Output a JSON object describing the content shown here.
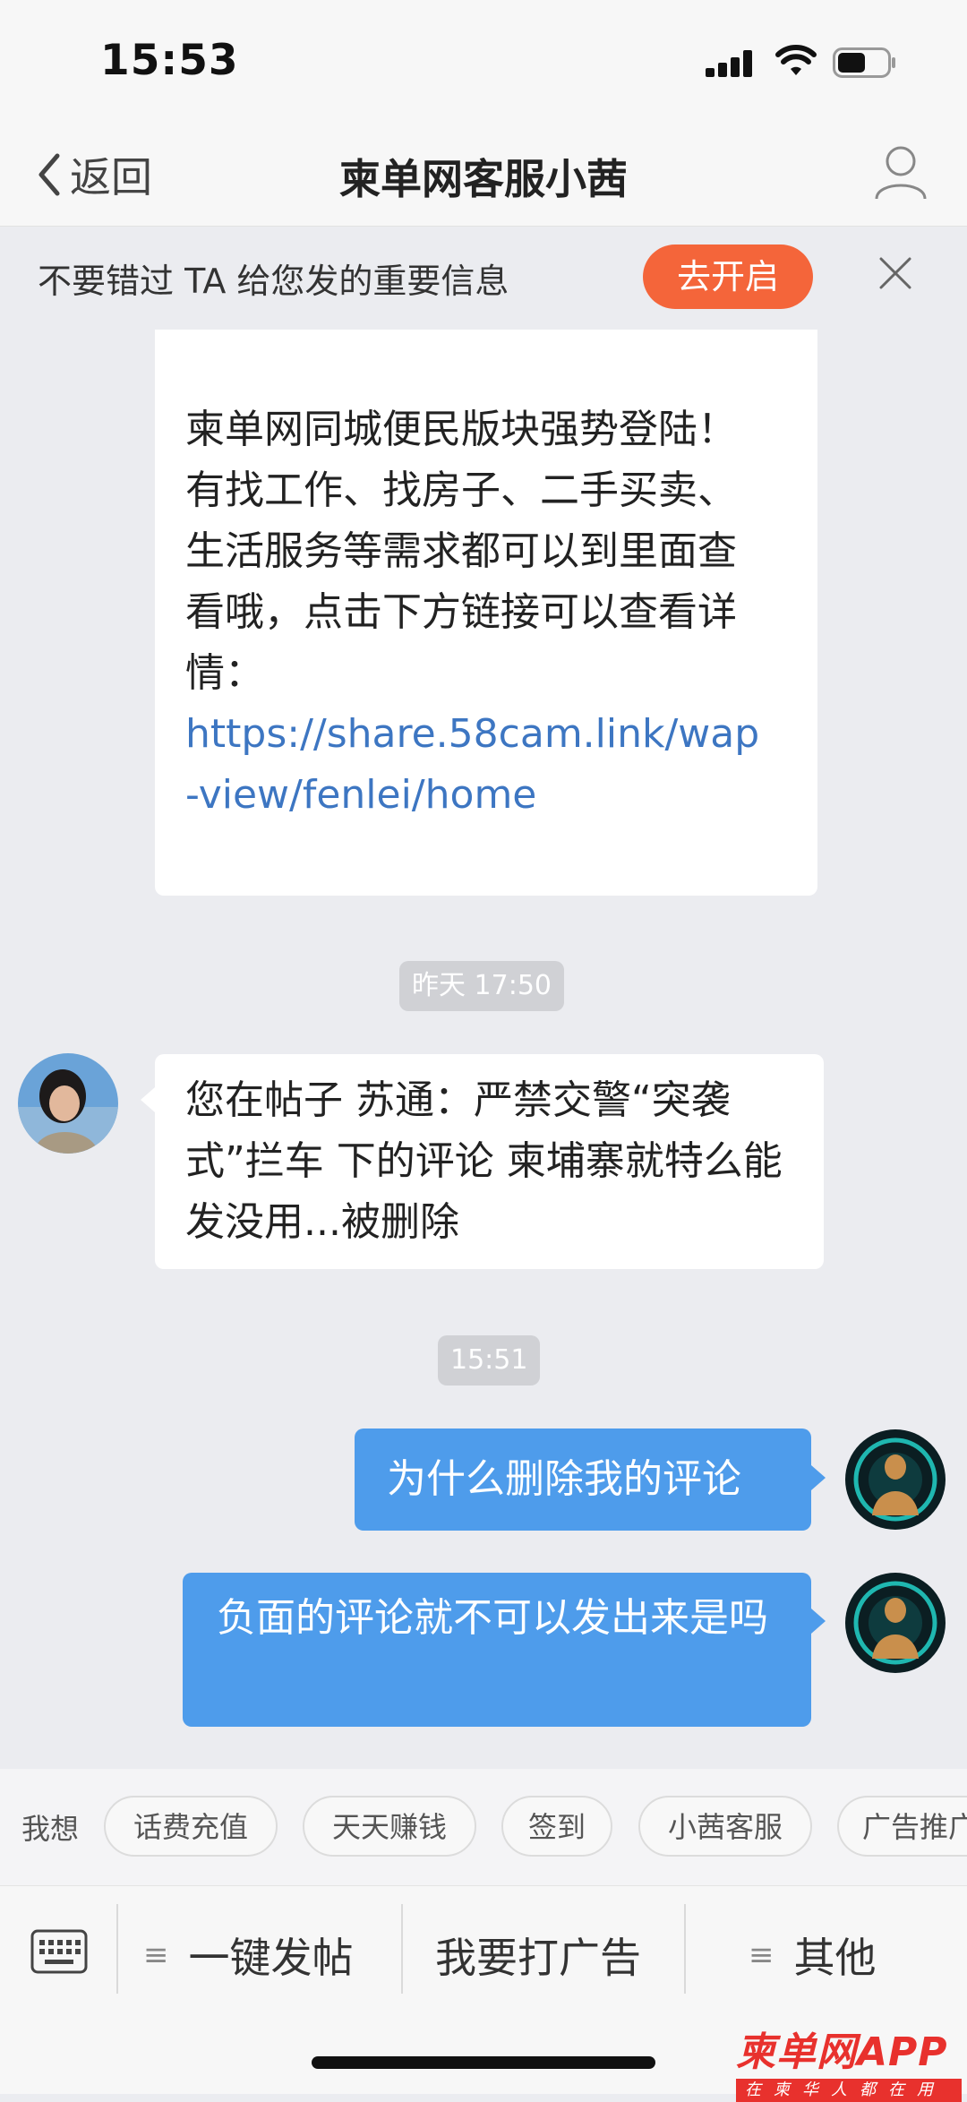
{
  "status_bar": {
    "time": "15:53"
  },
  "nav": {
    "back_label": "返回",
    "title": "柬单网客服小茜"
  },
  "banner": {
    "text": "不要错过 TA 给您发的重要信息",
    "button": "去开启"
  },
  "messages": {
    "m1_text": "柬单网同城便民版块强势登陆！有找工作、找房子、二手买卖、生活服务等需求都可以到里面查看哦，点击下方链接可以查看详情：",
    "m1_link": "https://share.58cam.link/wap-view/fenlei/home",
    "ts1": "昨天 17:50",
    "m2_text": "您在帖子 苏通：严禁交警“突袭式”拦车 下的评论 柬埔寨就特么能发没用...被删除",
    "ts2": "15:51",
    "m3_text": "为什么删除我的评论",
    "m4_text": "负面的评论就不可以发出来是吗"
  },
  "quick": {
    "label": "我想",
    "chips": [
      "话费充值",
      "天天赚钱",
      "签到",
      "小茜客服",
      "广告推广"
    ]
  },
  "menu": {
    "item1": "一键发帖",
    "item2": "我要打广告",
    "item3": "其他",
    "bars_glyph": "≡"
  },
  "watermark": {
    "title": "柬单网APP",
    "subtitle": "在柬华人都在用"
  },
  "colors": {
    "accent_orange": "#f4653a",
    "outgoing_bubble": "#4e9ceb",
    "link": "#3d76c2"
  }
}
